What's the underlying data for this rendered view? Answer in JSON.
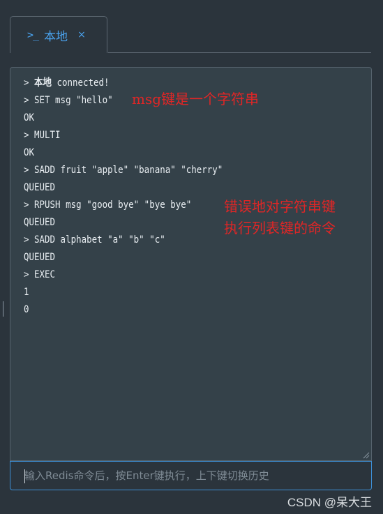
{
  "tab": {
    "icon": "terminal-icon",
    "prompt_symbol": ">_",
    "label": "本地",
    "close_symbol": "×"
  },
  "console": {
    "lines": [
      {
        "prefix": "> ",
        "cjk": "本地",
        "text": " connected!"
      },
      {
        "prefix": "> ",
        "cjk": "",
        "text": "SET msg \"hello\""
      },
      {
        "prefix": "",
        "cjk": "",
        "text": "OK"
      },
      {
        "prefix": "> ",
        "cjk": "",
        "text": "MULTI"
      },
      {
        "prefix": "",
        "cjk": "",
        "text": "OK"
      },
      {
        "prefix": "> ",
        "cjk": "",
        "text": "SADD fruit \"apple\" \"banana\" \"cherry\""
      },
      {
        "prefix": "",
        "cjk": "",
        "text": "QUEUED"
      },
      {
        "prefix": "> ",
        "cjk": "",
        "text": "RPUSH msg \"good bye\" \"bye bye\""
      },
      {
        "prefix": "",
        "cjk": "",
        "text": "QUEUED"
      },
      {
        "prefix": "> ",
        "cjk": "",
        "text": "SADD alphabet \"a\" \"b\" \"c\""
      },
      {
        "prefix": "",
        "cjk": "",
        "text": "QUEUED"
      },
      {
        "prefix": "> ",
        "cjk": "",
        "text": "EXEC"
      },
      {
        "prefix": "",
        "cjk": "",
        "text": "1"
      },
      {
        "prefix": "",
        "cjk": "",
        "text": "0"
      }
    ],
    "annotations": {
      "first": "msg键是一个字符串",
      "second_line1": "错误地对字符串键",
      "second_line2": "执行列表键的命令",
      "color": "#e02626"
    }
  },
  "input": {
    "placeholder": "输入Redis命令后，按Enter键执行，上下键切换历史",
    "value": ""
  },
  "watermark": "CSDN @呆大王",
  "colors": {
    "accent": "#4aa3ef",
    "background": "#2b343c",
    "console_bg": "#344149"
  }
}
